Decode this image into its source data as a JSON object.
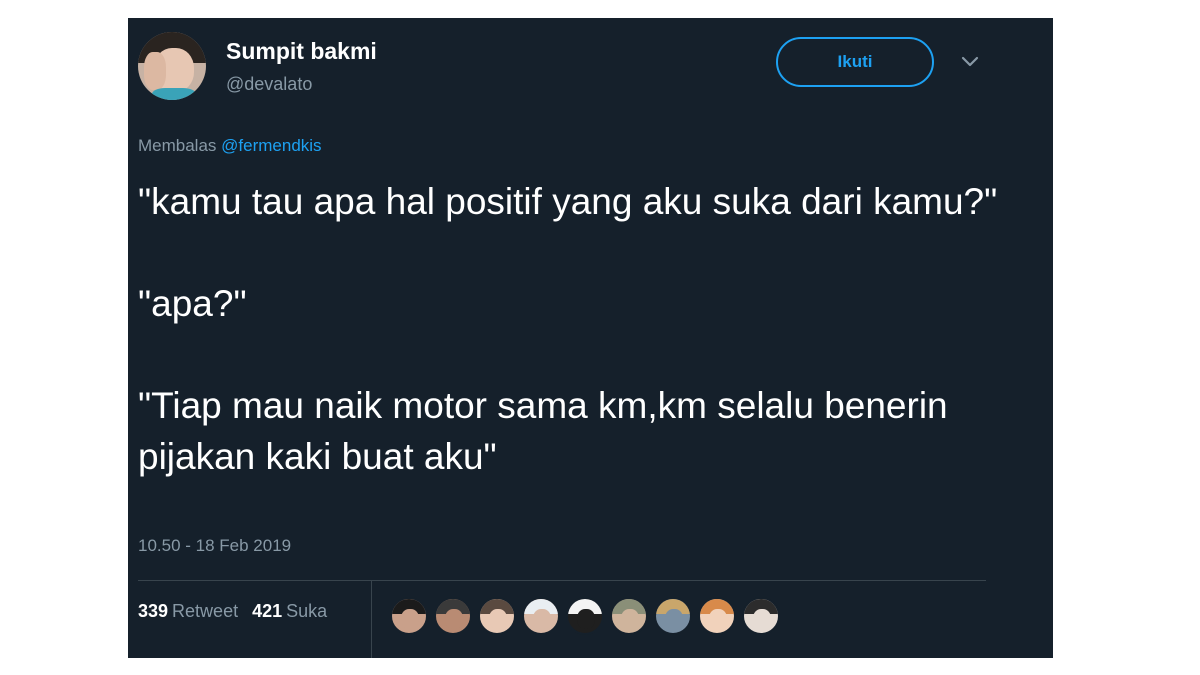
{
  "user": {
    "display_name": "Sumpit bakmi",
    "handle": "@devalato"
  },
  "follow_button": {
    "label": "Ikuti"
  },
  "reply": {
    "prefix": "Membalas",
    "mention": "@fermendkis"
  },
  "tweet": {
    "text": "\"kamu tau apa hal positif yang aku suka dari kamu?\"\n\n\"apa?\"\n\n\"Tiap mau naik motor sama km,km selalu benerin pijakan kaki buat aku\"",
    "timestamp": "10.50 - 18 Feb 2019"
  },
  "stats": {
    "retweets": {
      "count": "339",
      "label": "Retweet"
    },
    "likes": {
      "count": "421",
      "label": "Suka"
    }
  },
  "likers": [
    {
      "icon": "user-avatar-icon",
      "top": "#1b1b1b",
      "skin": "#c9a08a"
    },
    {
      "icon": "user-avatar-icon",
      "top": "#3a3a3a",
      "skin": "#b98b73"
    },
    {
      "icon": "user-avatar-icon",
      "top": "#5a4a40",
      "skin": "#e8c9b5"
    },
    {
      "icon": "user-avatar-icon",
      "top": "#e9eef2",
      "skin": "#d9b9a6"
    },
    {
      "icon": "user-avatar-icon",
      "top": "#f4f4f4",
      "skin": "#1f1f1f"
    },
    {
      "icon": "user-avatar-icon",
      "top": "#8a8f78",
      "skin": "#cfb49c"
    },
    {
      "icon": "user-avatar-icon",
      "top": "#c9a66b",
      "skin": "#7a8fa3"
    },
    {
      "icon": "user-avatar-icon",
      "top": "#d88a4a",
      "skin": "#f1d2bb"
    },
    {
      "icon": "user-avatar-icon",
      "top": "#2c2c2c",
      "skin": "#e6dcd4"
    }
  ],
  "colors": {
    "background": "#15202b",
    "accent": "#1da1f2",
    "muted": "#8899a6"
  }
}
